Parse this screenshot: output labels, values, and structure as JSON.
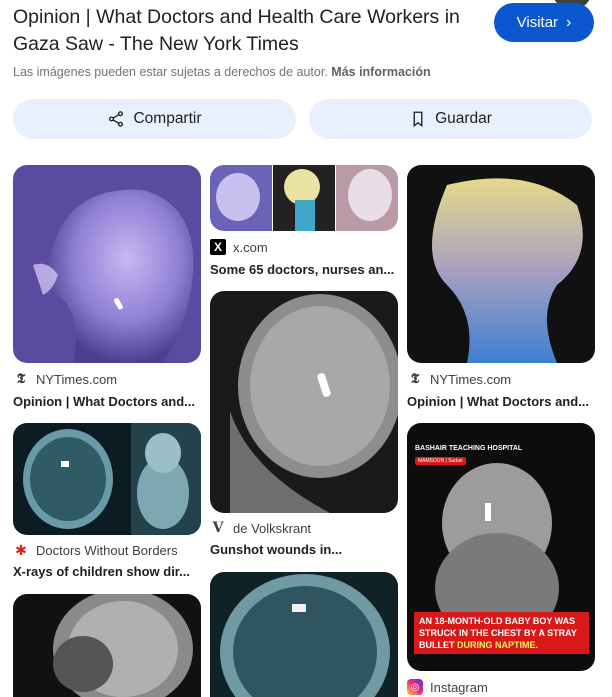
{
  "header": {
    "title": "Opinion | What Doctors and Health Care Workers in Gaza Saw - The New York Times",
    "visit_label": "Visitar",
    "copyright_text": "Las imágenes pueden estar sujetas a derechos de autor.",
    "copyright_more": "Más información"
  },
  "actions": {
    "share_label": "Compartir",
    "save_label": "Guardar"
  },
  "results": [
    {
      "source": "NYTimes.com",
      "caption": "Opinion | What Doctors and...",
      "icon": "nytimes-icon"
    },
    {
      "source": "x.com",
      "caption": "Some 65 doctors, nurses an...",
      "icon": "x-icon"
    },
    {
      "source": "NYTimes.com",
      "caption": "Opinion | What Doctors and...",
      "icon": "nytimes-icon"
    },
    {
      "source": "Doctors Without Borders",
      "caption": "X-rays of children show dir...",
      "icon": "msf-icon"
    },
    {
      "source": "de Volkskrant",
      "caption": "Gunshot wounds in...",
      "icon": "volkskrant-icon"
    },
    {
      "source": "Instagram",
      "caption": "",
      "icon": "instagram-icon"
    }
  ],
  "overlay": {
    "hospital": "BASHAIR TEACHING HOSPITAL",
    "tag": "MAMSOUN | Sudan",
    "banner_main": "AN 18-MONTH-OLD BABY BOY WAS STRUCK IN THE CHEST BY A STRAY BULLET",
    "banner_highlight": "DURING NAPTIME."
  },
  "colors": {
    "accent": "#0b57d0",
    "chip_bg": "#e8f0fe",
    "banner_red": "#d7191a"
  }
}
